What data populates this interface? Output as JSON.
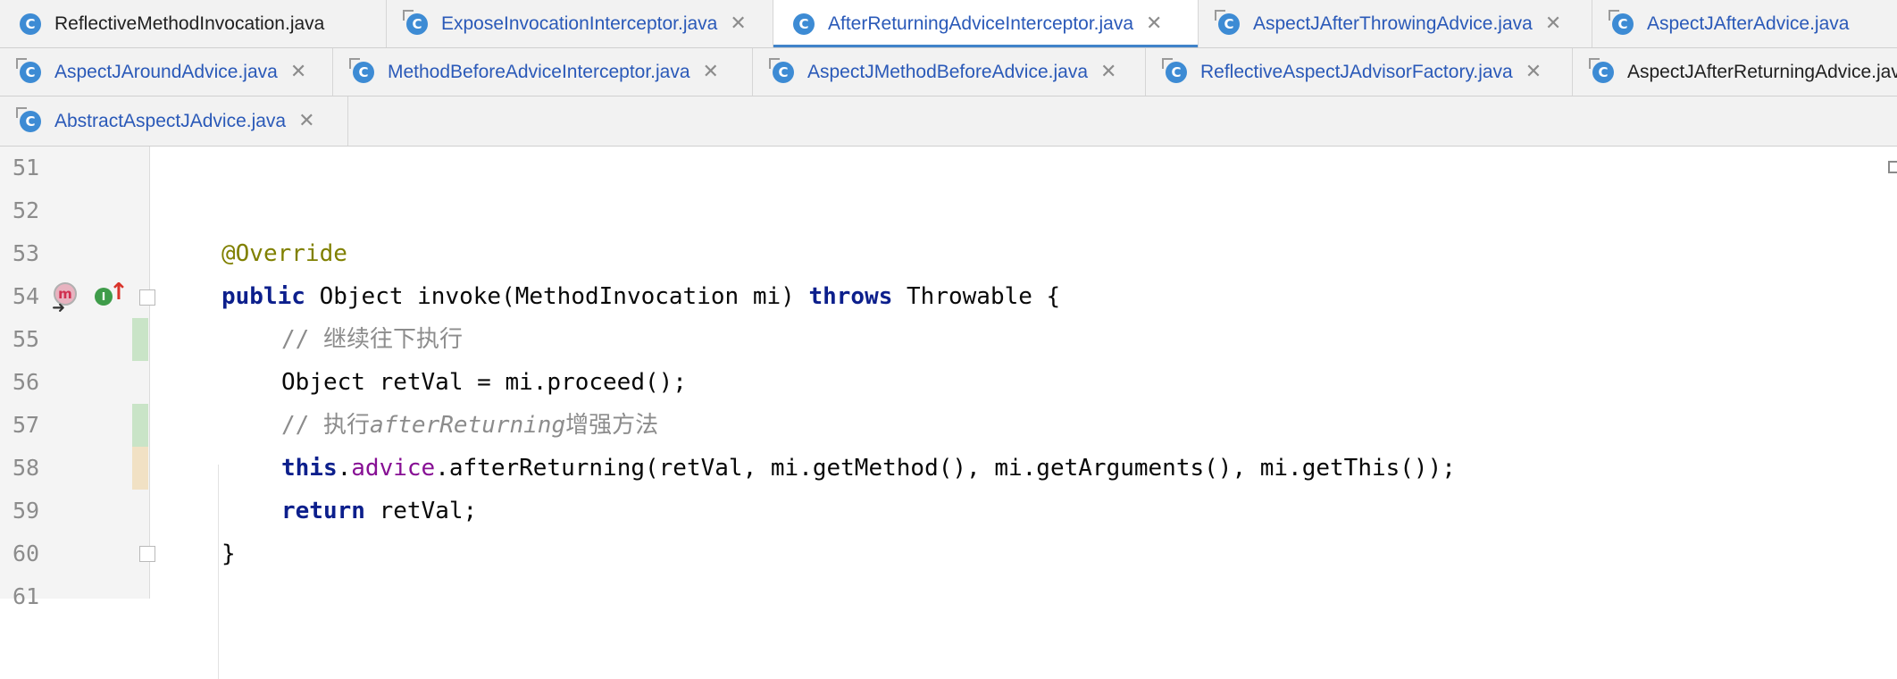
{
  "tabs": {
    "row1": [
      {
        "label": "ReflectiveMethodInvocation.java"
      },
      {
        "label": "ExposeInvocationInterceptor.java"
      },
      {
        "label": "AfterReturningAdviceInterceptor.java"
      },
      {
        "label": "AspectJAfterThrowingAdvice.java"
      },
      {
        "label": "AspectJAfterAdvice.java"
      }
    ],
    "row2": [
      {
        "label": "AspectJAroundAdvice.java"
      },
      {
        "label": "MethodBeforeAdviceInterceptor.java"
      },
      {
        "label": "AspectJMethodBeforeAdvice.java"
      },
      {
        "label": "ReflectiveAspectJAdvisorFactory.java"
      },
      {
        "label": "AspectJAfterReturningAdvice.java"
      }
    ],
    "row3": [
      {
        "label": "AbstractAspectJAdvice.java"
      }
    ],
    "active": "AfterReturningAdviceInterceptor.java",
    "close_glyph": "✕",
    "class_icon_letter": "C"
  },
  "editor": {
    "line_numbers": [
      "51",
      "52",
      "53",
      "54",
      "55",
      "56",
      "57",
      "58",
      "59",
      "60",
      "61"
    ],
    "code": {
      "l53_annotation": "@Override",
      "l54_public": "public",
      "l54_sig": " Object invoke(MethodInvocation mi) ",
      "l54_throws": "throws",
      "l54_rest": " Throwable {",
      "l55_comment": "// 继续往下执行",
      "l56_text": "Object retVal = mi.proceed();",
      "l57_comment_a": "// 执行",
      "l57_comment_b": "afterReturning",
      "l57_comment_c": "增强方法",
      "l58_this": "this",
      "l58_dot": ".",
      "l58_field": "advice",
      "l58_rest": ".afterReturning(retVal, mi.getMethod(), mi.getArguments(), mi.getThis());",
      "l59_return": "return",
      "l59_rest": " retVal;",
      "l60_brace": "}"
    },
    "gutter_icons": {
      "method_marker": "m",
      "interface_marker": "I",
      "implements_arrow": "↑",
      "step_arrow": "➜"
    },
    "change_markers": {
      "added_color": "#c9e4c7",
      "modified_color": "#f1e1c4"
    }
  },
  "colors": {
    "keyword": "#0c1f8c",
    "annotation": "#808000",
    "comment": "#8c8c8c",
    "field": "#871094",
    "tab_link": "#2a59b8",
    "active_underline": "#4083c9"
  }
}
